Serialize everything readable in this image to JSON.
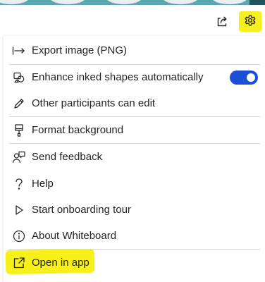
{
  "toolbar": {
    "share_icon": "share-icon",
    "settings_icon": "gear-icon",
    "highlight_color": "#f6f01e"
  },
  "menu": {
    "items": [
      {
        "label": "Export image (PNG)",
        "icon": "export-arrow-icon"
      },
      {
        "label": "Enhance inked shapes automatically",
        "icon": "shapes-icon",
        "toggle_on": true
      },
      {
        "label": "Other participants can edit",
        "icon": "pencil-icon"
      },
      {
        "label": "Format background",
        "icon": "format-brush-icon"
      },
      {
        "label": "Send feedback",
        "icon": "feedback-person-icon"
      },
      {
        "label": "Help",
        "icon": "question-icon"
      },
      {
        "label": "Start onboarding tour",
        "icon": "play-icon"
      },
      {
        "label": "About Whiteboard",
        "icon": "info-icon"
      },
      {
        "label": "Open in app",
        "icon": "open-external-icon"
      }
    ],
    "toggle_color": "#1b4fd6",
    "highlight_color": "#f7f019"
  }
}
